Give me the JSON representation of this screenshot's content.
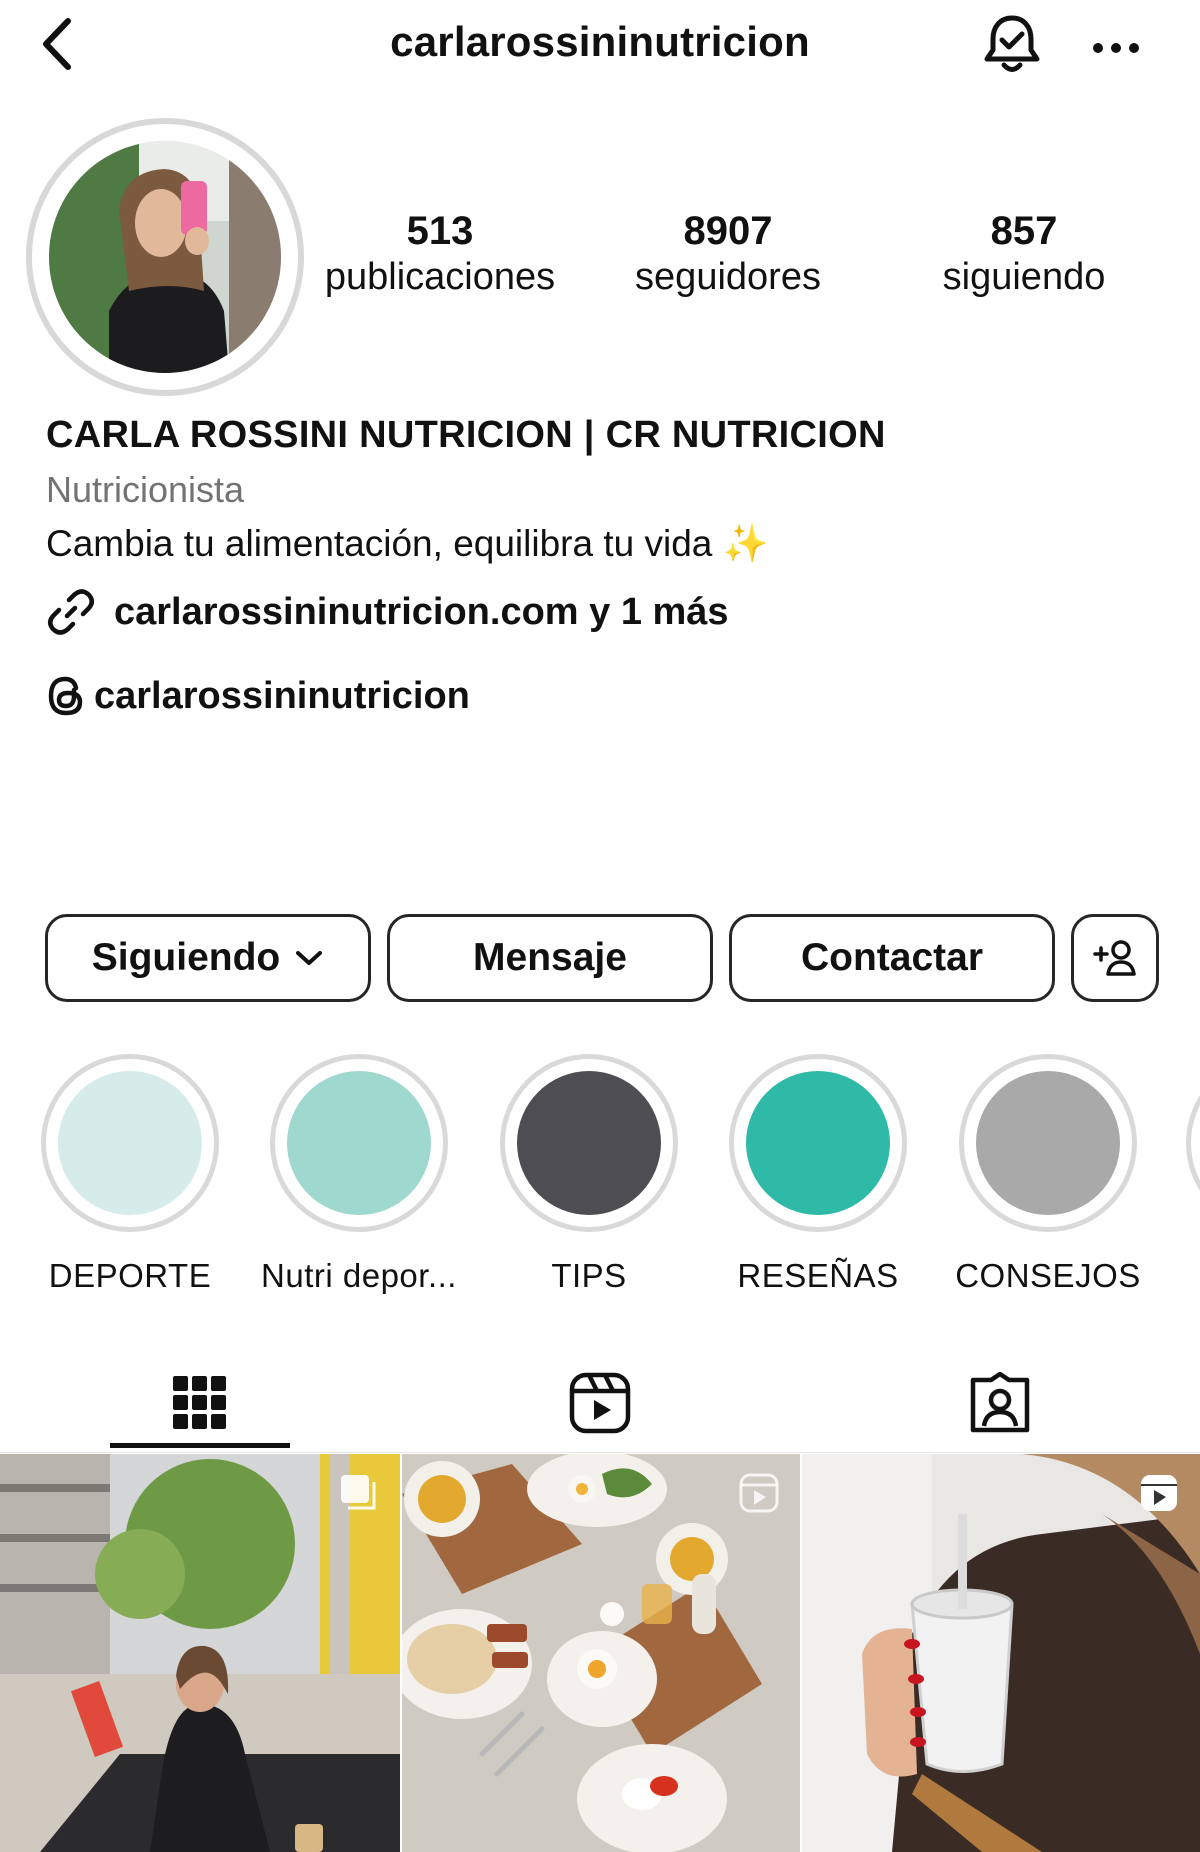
{
  "header": {
    "username": "carlarossininutricion",
    "back_icon": "chevron-left-icon",
    "bell_icon": "bell-check-icon",
    "more_icon": "more-horizontal-icon"
  },
  "stats": [
    {
      "value": "513",
      "label": "publicaciones"
    },
    {
      "value": "8907",
      "label": "seguidores"
    },
    {
      "value": "857",
      "label": "siguiendo"
    }
  ],
  "bio": {
    "full_name": "CARLA ROSSINI NUTRICION | CR NUTRICION",
    "category": "Nutricionista",
    "text": "Cambia tu alimentación, equilibra tu vida",
    "emoji": "✨",
    "link": "carlarossininutricion.com y 1 más",
    "threads_handle": "carlarossininutricion"
  },
  "actions": {
    "following_label": "Siguiendo",
    "message_label": "Mensaje",
    "contact_label": "Contactar",
    "add_user_icon": "add-user-icon"
  },
  "highlights": [
    {
      "label": "DEPORTE",
      "color": "#d6ecea"
    },
    {
      "label": "Nutri depor...",
      "color": "#9ed8cf"
    },
    {
      "label": "TIPS",
      "color": "#4e4d52"
    },
    {
      "label": "RESEÑAS",
      "color": "#2ebaa7"
    },
    {
      "label": "CONSEJOS",
      "color": "#a9a9a9"
    }
  ],
  "tabs": [
    {
      "icon": "grid-icon",
      "active": true
    },
    {
      "icon": "reels-icon",
      "active": false
    },
    {
      "icon": "tagged-icon",
      "active": false
    }
  ],
  "colors": {
    "text": "#111111",
    "muted": "#737373",
    "border": "#262626",
    "ring": "#d8d8d8"
  }
}
